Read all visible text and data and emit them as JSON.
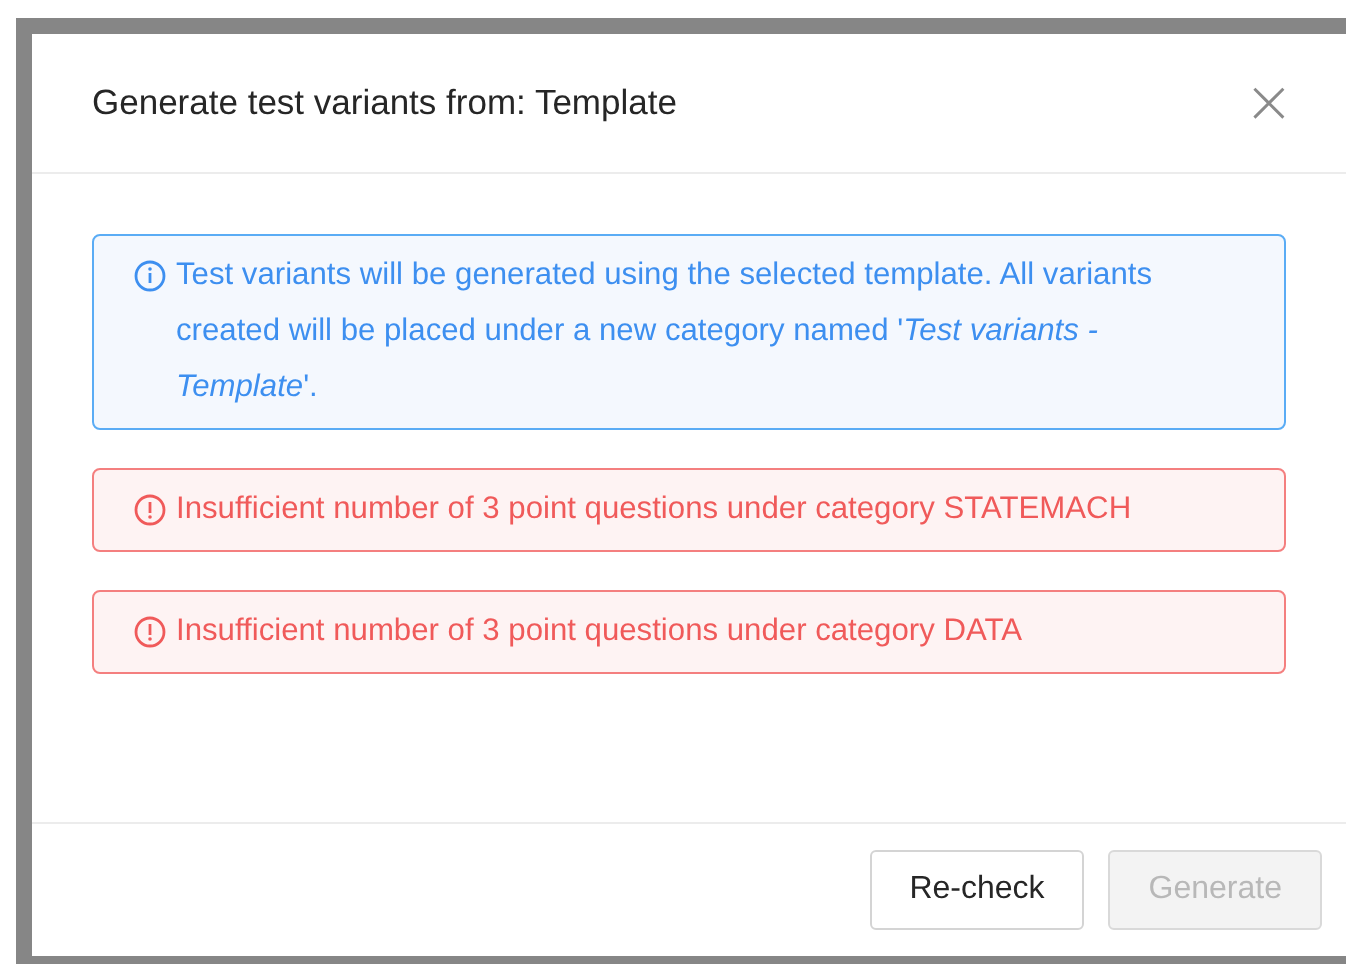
{
  "dialog": {
    "title": "Generate test variants from: Template",
    "close_icon": "×"
  },
  "messages": [
    {
      "kind": "info",
      "text": "Test variants will be generated using the selected template. All variants created will be placed under a new category named '*Test variants - Template*'."
    },
    {
      "kind": "error",
      "text": "Insufficient number of 3 point questions under category STATEMACH"
    },
    {
      "kind": "error",
      "text": "Insufficient number of 3 point questions under category DATA"
    }
  ],
  "buttons": [
    {
      "label": "Re-check",
      "disabled": false
    },
    {
      "label": "Generate",
      "disabled": true
    }
  ]
}
